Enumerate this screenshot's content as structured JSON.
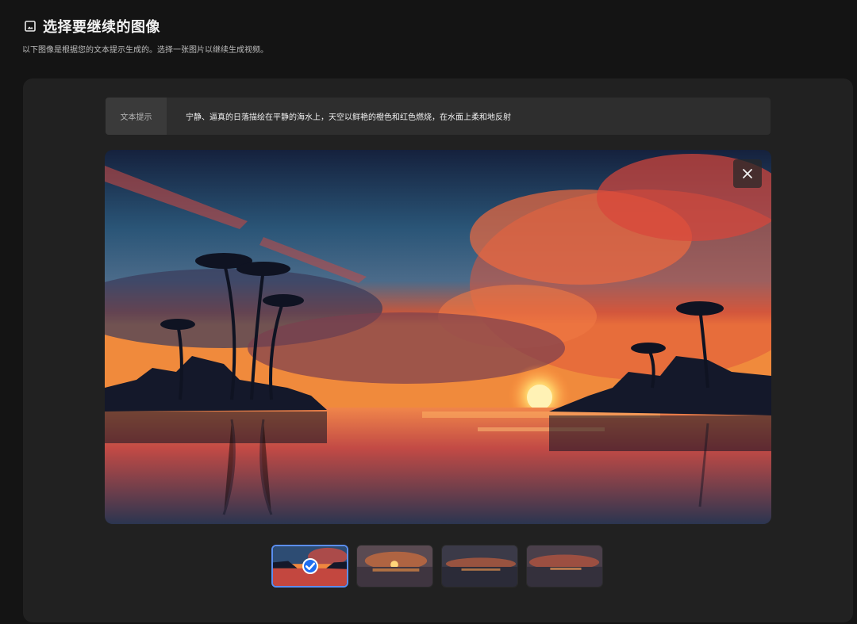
{
  "header": {
    "title": "选择要继续的图像",
    "subtitle": "以下图像是根据您的文本提示生成的。选择一张图片以继续生成视频。",
    "icon": "image-icon"
  },
  "prompt": {
    "label": "文本提示",
    "text": "宁静、逼真的日落描绘在平静的海水上，天空以鲜艳的橙色和红色燃烧，在水面上柔和地反射"
  },
  "viewer": {
    "close_icon": "close-icon"
  },
  "thumbnails": {
    "count": 4,
    "selected_index": 0,
    "check_icon": "check-icon"
  },
  "colors": {
    "accent": "#1e6ef0",
    "selected_border": "#5b8ef0",
    "background": "#141414",
    "panel": "#212121"
  }
}
